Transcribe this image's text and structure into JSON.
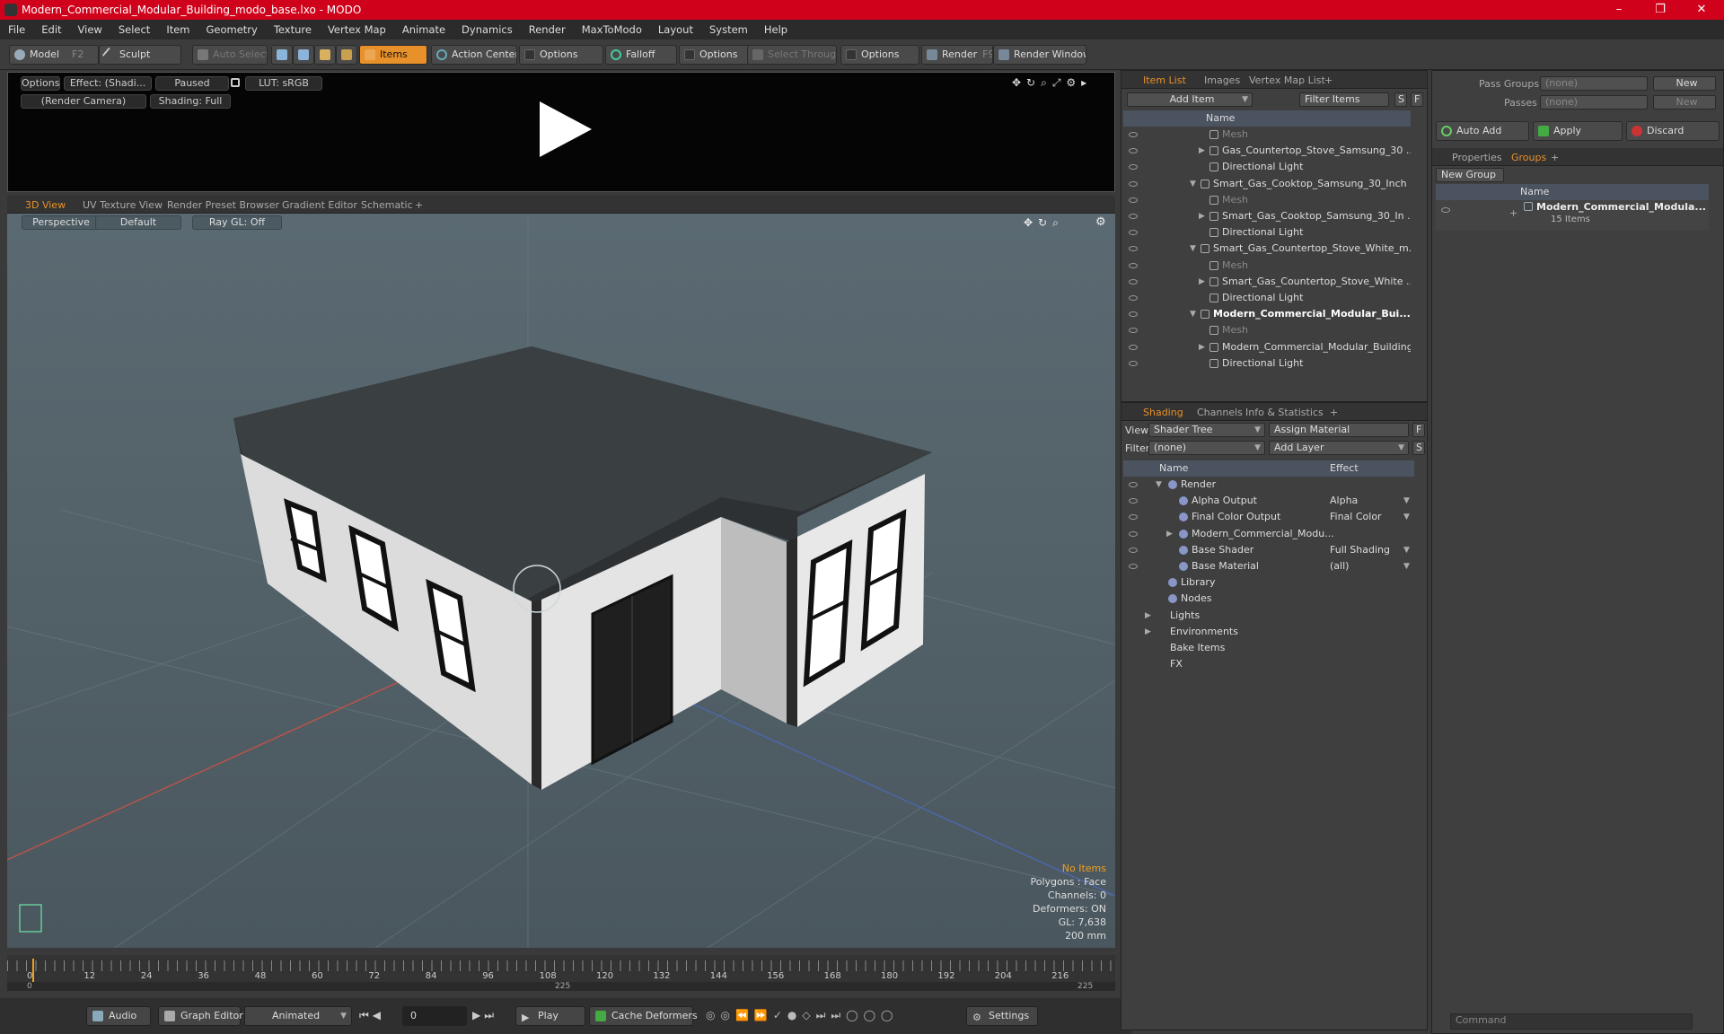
{
  "window": {
    "title": "Modern_Commercial_Modular_Building_modo_base.lxo - MODO",
    "min": "–",
    "max": "❐",
    "close": "✕"
  },
  "menu": [
    "File",
    "Edit",
    "View",
    "Select",
    "Item",
    "Geometry",
    "Texture",
    "Vertex Map",
    "Animate",
    "Dynamics",
    "Render",
    "MaxToModo",
    "Layout",
    "System",
    "Help"
  ],
  "toolbar": {
    "model": "Model",
    "model_key": "F2",
    "sculpt": "Sculpt",
    "auto_select": "Auto Select",
    "items": "Items",
    "action_center": "Action Center",
    "options1": "Options",
    "falloff": "Falloff",
    "options2": "Options",
    "select_through": "Select Through",
    "options3": "Options",
    "render": "Render",
    "render_key": "F9",
    "render_window": "Render Window"
  },
  "preview": {
    "options": "Options",
    "effect": "Effect: (Shadi...",
    "paused": "Paused",
    "lut": "LUT: sRGB",
    "camera": "(Render Camera)",
    "shading": "Shading: Full"
  },
  "viewport_tabs": [
    "3D View",
    "UV Texture View",
    "Render Preset Browser",
    "Gradient Editor",
    "Schematic",
    "+"
  ],
  "viewport": {
    "perspective": "Perspective",
    "default": "Default",
    "raygl": "Ray GL: Off",
    "info": {
      "no_items": "No Items",
      "polygons": "Polygons : Face",
      "channels": "Channels: 0",
      "deformers": "Deformers: ON",
      "gl": "GL: 7,638",
      "size": "200 mm"
    }
  },
  "timeline": {
    "ticks": [
      "0",
      "12",
      "24",
      "36",
      "48",
      "60",
      "72",
      "84",
      "96",
      "108",
      "120",
      "132",
      "144",
      "156",
      "168",
      "180",
      "192",
      "204",
      "216"
    ],
    "start": "0",
    "mid": "225",
    "end": "225"
  },
  "bottombar": {
    "audio": "Audio",
    "graph_editor": "Graph Editor",
    "animated": "Animated",
    "frame": "0",
    "play": "Play",
    "cache_deformers": "Cache Deformers",
    "settings": "Settings"
  },
  "itemlist": {
    "tabs": [
      "Item List",
      "Images",
      "Vertex Map List",
      "+"
    ],
    "add_item": "Add Item",
    "filter_items": "Filter Items",
    "s": "S",
    "f": "F",
    "name_col": "Name",
    "rows": [
      {
        "indent": 2,
        "text": "Mesh",
        "dim": true,
        "arrow": ""
      },
      {
        "indent": 2,
        "text": "Gas_Countertop_Stove_Samsung_30 ...",
        "dim": false,
        "arrow": "▶"
      },
      {
        "indent": 2,
        "text": "Directional Light",
        "dim": false,
        "arrow": ""
      },
      {
        "indent": 1,
        "text": "Smart_Gas_Cooktop_Samsung_30_Inch ...",
        "dim": false,
        "arrow": "▼"
      },
      {
        "indent": 2,
        "text": "Mesh",
        "dim": true,
        "arrow": ""
      },
      {
        "indent": 2,
        "text": "Smart_Gas_Cooktop_Samsung_30_In ...",
        "dim": false,
        "arrow": "▶"
      },
      {
        "indent": 2,
        "text": "Directional Light",
        "dim": false,
        "arrow": ""
      },
      {
        "indent": 1,
        "text": "Smart_Gas_Countertop_Stove_White_m...",
        "dim": false,
        "arrow": "▼"
      },
      {
        "indent": 2,
        "text": "Mesh",
        "dim": true,
        "arrow": ""
      },
      {
        "indent": 2,
        "text": "Smart_Gas_Countertop_Stove_White ...",
        "dim": false,
        "arrow": "▶"
      },
      {
        "indent": 2,
        "text": "Directional Light",
        "dim": false,
        "arrow": ""
      },
      {
        "indent": 1,
        "text": "Modern_Commercial_Modular_Bui...",
        "dim": false,
        "bold": true,
        "arrow": "▼"
      },
      {
        "indent": 2,
        "text": "Mesh",
        "dim": true,
        "arrow": ""
      },
      {
        "indent": 2,
        "text": "Modern_Commercial_Modular_Building...",
        "dim": false,
        "arrow": "▶"
      },
      {
        "indent": 2,
        "text": "Directional Light",
        "dim": false,
        "arrow": ""
      }
    ]
  },
  "shading": {
    "tabs": [
      "Shading",
      "Channels",
      "Info & Statistics",
      "+"
    ],
    "view_label": "View",
    "view_value": "Shader Tree",
    "assign_material": "Assign Material",
    "filter_label": "Filter",
    "filter_value": "(none)",
    "add_layer": "Add Layer",
    "f": "F",
    "s": "S",
    "name_col": "Name",
    "effect_col": "Effect",
    "rows": [
      {
        "indent": 0,
        "text": "Render",
        "effect": "",
        "arrow": "▼",
        "eye": true
      },
      {
        "indent": 1,
        "text": "Alpha Output",
        "effect": "Alpha",
        "arrow": "",
        "eye": true
      },
      {
        "indent": 1,
        "text": "Final Color Output",
        "effect": "Final Color",
        "arrow": "",
        "eye": true
      },
      {
        "indent": 1,
        "text": "Modern_Commercial_Modu...",
        "effect": "",
        "arrow": "▶",
        "eye": true
      },
      {
        "indent": 1,
        "text": "Base Shader",
        "effect": "Full Shading",
        "arrow": "",
        "eye": true
      },
      {
        "indent": 1,
        "text": "Base Material",
        "effect": "(all)",
        "arrow": "",
        "eye": true
      },
      {
        "indent": 0,
        "text": "Library",
        "effect": "",
        "arrow": "",
        "eye": false
      },
      {
        "indent": 0,
        "text": "Nodes",
        "effect": "",
        "arrow": "",
        "eye": false
      },
      {
        "indent": -1,
        "text": "Lights",
        "effect": "",
        "arrow": "▶",
        "eye": false
      },
      {
        "indent": -1,
        "text": "Environments",
        "effect": "",
        "arrow": "▶",
        "eye": false
      },
      {
        "indent": -1,
        "text": "Bake Items",
        "effect": "",
        "arrow": "",
        "eye": false
      },
      {
        "indent": -1,
        "text": "FX",
        "effect": "",
        "arrow": "",
        "eye": false
      }
    ]
  },
  "groups": {
    "pass_groups": "Pass Groups",
    "pass_value": "(none)",
    "new": "New",
    "passes": "Passes",
    "passes_value": "(none)",
    "new2": "New",
    "auto_add": "Auto Add",
    "apply": "Apply",
    "discard": "Discard",
    "tabs": [
      "Properties",
      "Groups",
      "+"
    ],
    "new_group": "New Group",
    "name_col": "Name",
    "item_name": "Modern_Commercial_Modula...",
    "item_count": "15 Items",
    "command": "Command"
  }
}
